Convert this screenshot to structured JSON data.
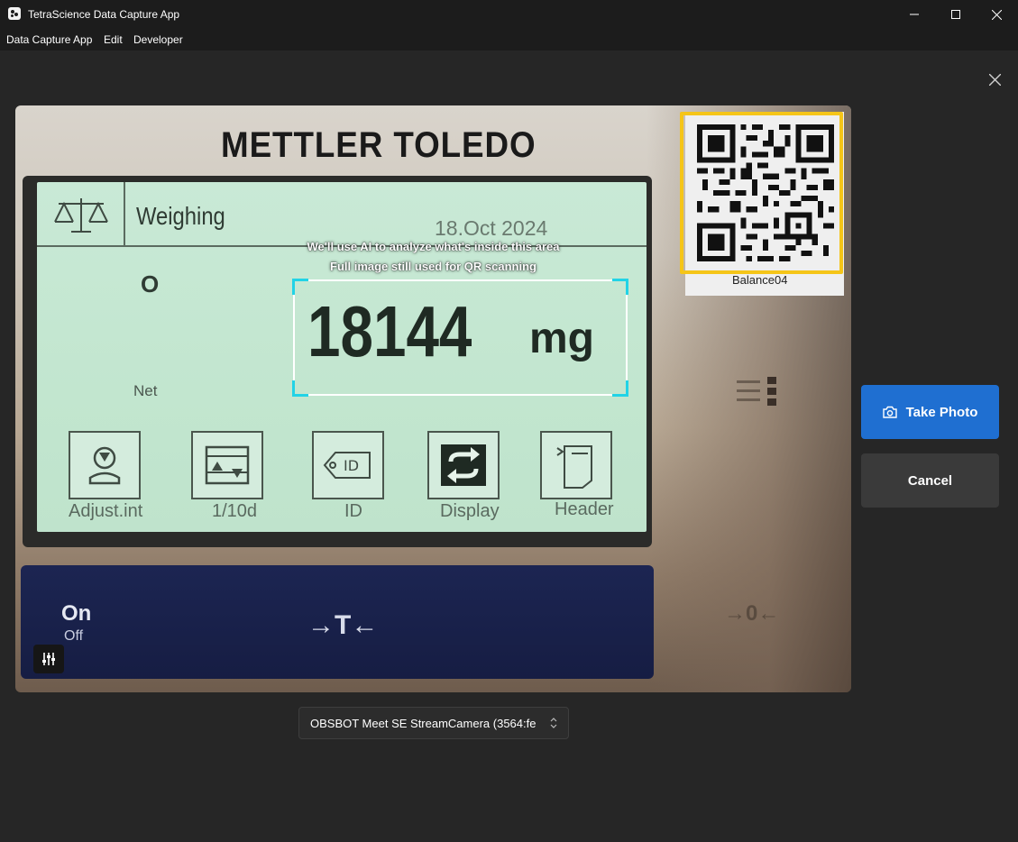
{
  "window": {
    "title": "TetraScience Data Capture App",
    "controls": {
      "minimize": "minimize-icon",
      "maximize": "maximize-icon",
      "close": "close-icon"
    }
  },
  "menu": {
    "items": [
      {
        "label": "Data Capture App"
      },
      {
        "label": "Edit"
      },
      {
        "label": "Developer"
      }
    ]
  },
  "camera_view": {
    "scene": {
      "brand": "METTLER TOLEDO",
      "screen_title": "Weighing",
      "date": "18.Oct 2024",
      "status_symbol": "O",
      "weight_value": "18144",
      "weight_unit": "mg",
      "net_label": "Net",
      "keys": [
        {
          "label": "Adjust.int"
        },
        {
          "label": "1/10d"
        },
        {
          "label": "ID"
        },
        {
          "label": "Display"
        },
        {
          "label": "Header"
        }
      ],
      "key_id_text": "ID",
      "on_label": "On",
      "off_label": "Off",
      "tare_symbol": "→T←",
      "zero_symbol": "→0←",
      "qr_label": "Balance04"
    },
    "ai_area": {
      "line1": "We'll use AI to analyze what's inside this area",
      "line2": "Full image still used for QR scanning",
      "corner_color": "#22d3e6"
    },
    "qr_highlight_color": "#f5c518",
    "settings_icon": "sliders-icon"
  },
  "actions": {
    "take_photo": "Take Photo",
    "take_photo_icon": "camera-icon",
    "cancel": "Cancel"
  },
  "camera_select": {
    "value": "OBSBOT Meet SE StreamCamera (3564:fe"
  },
  "colors": {
    "primary": "#1f6fd1",
    "background": "#262626",
    "titlebar": "#1c1c1c"
  }
}
